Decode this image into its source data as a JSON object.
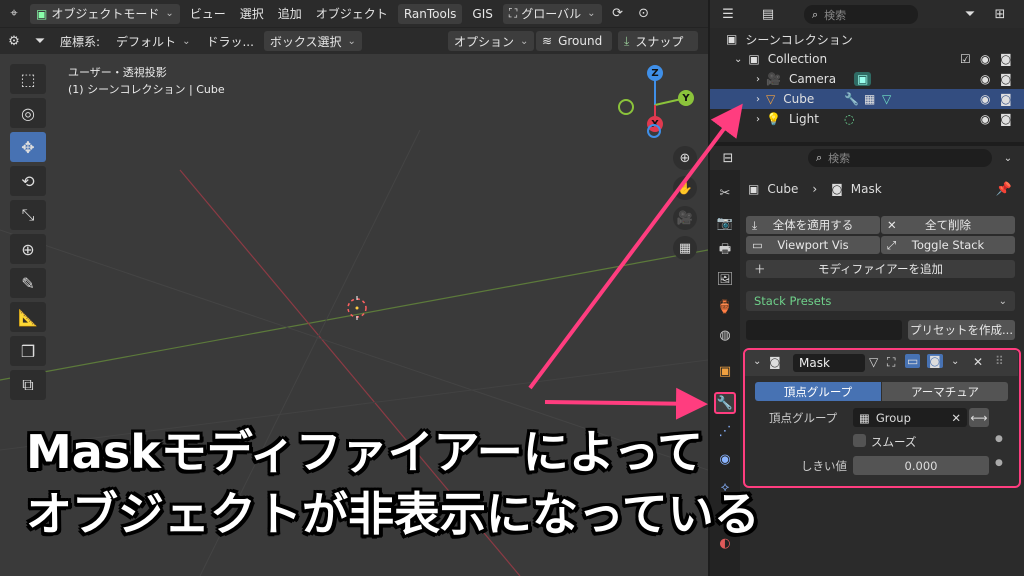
{
  "viewport_header": {
    "mode": "オブジェクトモード",
    "menus": [
      "ビュー",
      "選択",
      "追加",
      "オブジェクト"
    ],
    "rantools": "RanTools",
    "gis": "GIS",
    "transform": "グローバル"
  },
  "viewport_header2": {
    "coord_label": "座標系:",
    "coord_value": "デフォルト",
    "drag_label": "ドラッ...",
    "drag_value": "ボックス選択",
    "options": "オプション",
    "ground": "Ground",
    "snap": "スナップ"
  },
  "viewport_info": {
    "line1": "ユーザー・透視投影",
    "line2": "(1) シーンコレクション | Cube"
  },
  "gizmo": {
    "z": "Z",
    "y": "Y",
    "x": "X"
  },
  "outliner": {
    "search_placeholder": "検索",
    "scene": "シーンコレクション",
    "collection": "Collection",
    "items": [
      "Camera",
      "Cube",
      "Light"
    ]
  },
  "properties": {
    "search_placeholder": "検索",
    "breadcrumb_object": "Cube",
    "breadcrumb_modifier": "Mask",
    "apply_all": "全体を適用する",
    "delete_all": "全て削除",
    "viewport_vis": "Viewport Vis",
    "toggle_stack": "Toggle Stack",
    "add_modifier": "モディファイアーを追加",
    "stack_presets": "Stack Presets",
    "preset_create": "プリセットを作成...",
    "modifier": {
      "name": "Mask",
      "mode_vertex_group": "頂点グループ",
      "mode_armature": "アーマチュア",
      "vertex_group_label": "頂点グループ",
      "vertex_group_value": "Group",
      "smooth_label": "スムーズ",
      "threshold_label": "しきい値",
      "threshold_value": "0.000"
    }
  },
  "caption": {
    "line1": "Maskモディファイアーによって",
    "line2": "オブジェクトが非表示になっている"
  },
  "colors": {
    "accent_blue": "#4772b3",
    "selection_row": "#334d80",
    "annotation_pink": "#ff3d7f",
    "axis_x": "#e0394f",
    "axis_y": "#8bc33b",
    "axis_z": "#3f8fe8"
  }
}
